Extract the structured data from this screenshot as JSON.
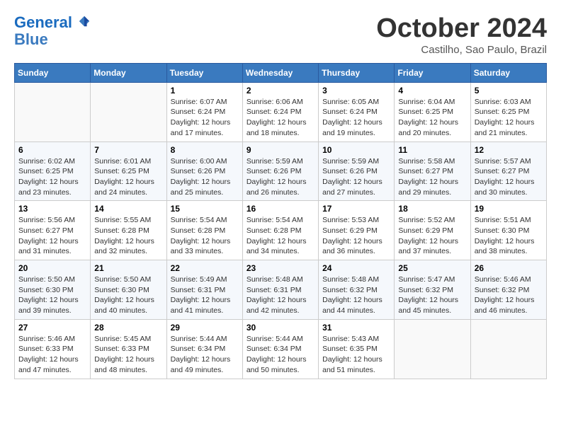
{
  "header": {
    "logo_line1": "General",
    "logo_line2": "Blue",
    "month_title": "October 2024",
    "subtitle": "Castilho, Sao Paulo, Brazil"
  },
  "weekdays": [
    "Sunday",
    "Monday",
    "Tuesday",
    "Wednesday",
    "Thursday",
    "Friday",
    "Saturday"
  ],
  "rows": [
    [
      {
        "day": "",
        "info": ""
      },
      {
        "day": "",
        "info": ""
      },
      {
        "day": "1",
        "info": "Sunrise: 6:07 AM\nSunset: 6:24 PM\nDaylight: 12 hours\nand 17 minutes."
      },
      {
        "day": "2",
        "info": "Sunrise: 6:06 AM\nSunset: 6:24 PM\nDaylight: 12 hours\nand 18 minutes."
      },
      {
        "day": "3",
        "info": "Sunrise: 6:05 AM\nSunset: 6:24 PM\nDaylight: 12 hours\nand 19 minutes."
      },
      {
        "day": "4",
        "info": "Sunrise: 6:04 AM\nSunset: 6:25 PM\nDaylight: 12 hours\nand 20 minutes."
      },
      {
        "day": "5",
        "info": "Sunrise: 6:03 AM\nSunset: 6:25 PM\nDaylight: 12 hours\nand 21 minutes."
      }
    ],
    [
      {
        "day": "6",
        "info": "Sunrise: 6:02 AM\nSunset: 6:25 PM\nDaylight: 12 hours\nand 23 minutes."
      },
      {
        "day": "7",
        "info": "Sunrise: 6:01 AM\nSunset: 6:25 PM\nDaylight: 12 hours\nand 24 minutes."
      },
      {
        "day": "8",
        "info": "Sunrise: 6:00 AM\nSunset: 6:26 PM\nDaylight: 12 hours\nand 25 minutes."
      },
      {
        "day": "9",
        "info": "Sunrise: 5:59 AM\nSunset: 6:26 PM\nDaylight: 12 hours\nand 26 minutes."
      },
      {
        "day": "10",
        "info": "Sunrise: 5:59 AM\nSunset: 6:26 PM\nDaylight: 12 hours\nand 27 minutes."
      },
      {
        "day": "11",
        "info": "Sunrise: 5:58 AM\nSunset: 6:27 PM\nDaylight: 12 hours\nand 29 minutes."
      },
      {
        "day": "12",
        "info": "Sunrise: 5:57 AM\nSunset: 6:27 PM\nDaylight: 12 hours\nand 30 minutes."
      }
    ],
    [
      {
        "day": "13",
        "info": "Sunrise: 5:56 AM\nSunset: 6:27 PM\nDaylight: 12 hours\nand 31 minutes."
      },
      {
        "day": "14",
        "info": "Sunrise: 5:55 AM\nSunset: 6:28 PM\nDaylight: 12 hours\nand 32 minutes."
      },
      {
        "day": "15",
        "info": "Sunrise: 5:54 AM\nSunset: 6:28 PM\nDaylight: 12 hours\nand 33 minutes."
      },
      {
        "day": "16",
        "info": "Sunrise: 5:54 AM\nSunset: 6:28 PM\nDaylight: 12 hours\nand 34 minutes."
      },
      {
        "day": "17",
        "info": "Sunrise: 5:53 AM\nSunset: 6:29 PM\nDaylight: 12 hours\nand 36 minutes."
      },
      {
        "day": "18",
        "info": "Sunrise: 5:52 AM\nSunset: 6:29 PM\nDaylight: 12 hours\nand 37 minutes."
      },
      {
        "day": "19",
        "info": "Sunrise: 5:51 AM\nSunset: 6:30 PM\nDaylight: 12 hours\nand 38 minutes."
      }
    ],
    [
      {
        "day": "20",
        "info": "Sunrise: 5:50 AM\nSunset: 6:30 PM\nDaylight: 12 hours\nand 39 minutes."
      },
      {
        "day": "21",
        "info": "Sunrise: 5:50 AM\nSunset: 6:30 PM\nDaylight: 12 hours\nand 40 minutes."
      },
      {
        "day": "22",
        "info": "Sunrise: 5:49 AM\nSunset: 6:31 PM\nDaylight: 12 hours\nand 41 minutes."
      },
      {
        "day": "23",
        "info": "Sunrise: 5:48 AM\nSunset: 6:31 PM\nDaylight: 12 hours\nand 42 minutes."
      },
      {
        "day": "24",
        "info": "Sunrise: 5:48 AM\nSunset: 6:32 PM\nDaylight: 12 hours\nand 44 minutes."
      },
      {
        "day": "25",
        "info": "Sunrise: 5:47 AM\nSunset: 6:32 PM\nDaylight: 12 hours\nand 45 minutes."
      },
      {
        "day": "26",
        "info": "Sunrise: 5:46 AM\nSunset: 6:32 PM\nDaylight: 12 hours\nand 46 minutes."
      }
    ],
    [
      {
        "day": "27",
        "info": "Sunrise: 5:46 AM\nSunset: 6:33 PM\nDaylight: 12 hours\nand 47 minutes."
      },
      {
        "day": "28",
        "info": "Sunrise: 5:45 AM\nSunset: 6:33 PM\nDaylight: 12 hours\nand 48 minutes."
      },
      {
        "day": "29",
        "info": "Sunrise: 5:44 AM\nSunset: 6:34 PM\nDaylight: 12 hours\nand 49 minutes."
      },
      {
        "day": "30",
        "info": "Sunrise: 5:44 AM\nSunset: 6:34 PM\nDaylight: 12 hours\nand 50 minutes."
      },
      {
        "day": "31",
        "info": "Sunrise: 5:43 AM\nSunset: 6:35 PM\nDaylight: 12 hours\nand 51 minutes."
      },
      {
        "day": "",
        "info": ""
      },
      {
        "day": "",
        "info": ""
      }
    ]
  ]
}
